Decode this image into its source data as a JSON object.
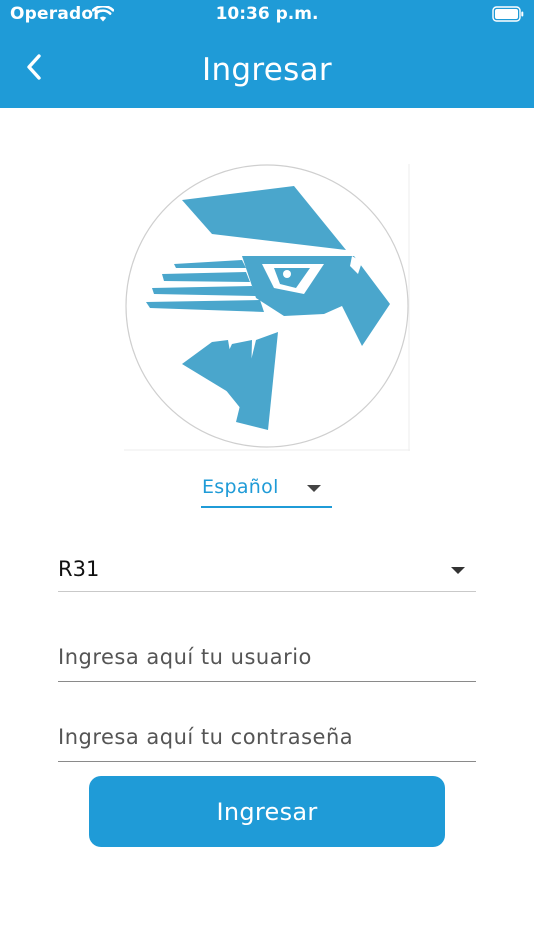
{
  "status_bar": {
    "carrier": "Operador",
    "time": "10:36 p.m.",
    "wifi_icon": "wifi-icon",
    "battery_icon": "battery-icon"
  },
  "header": {
    "title": "Ingresar",
    "back_icon": "chevron-left-icon",
    "background_color": "#1f9bd7"
  },
  "logo": {
    "icon": "eagle-head-logo",
    "color": "#4aa6cc"
  },
  "language_select": {
    "selected": "Español"
  },
  "server_select": {
    "selected": "R31"
  },
  "form": {
    "username_placeholder": "Ingresa aquí tu usuario",
    "password_placeholder": "Ingresa aquí tu contraseña",
    "submit_label": "Ingresar"
  },
  "colors": {
    "accent": "#1f9bd7",
    "text": "#111111"
  }
}
